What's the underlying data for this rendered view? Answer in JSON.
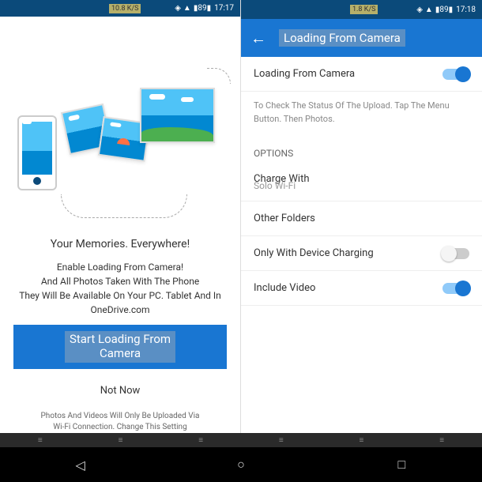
{
  "statusbar": {
    "left": {
      "speed": "10.8 K/S",
      "time": "17:17"
    },
    "right": {
      "speed": "1.8 K/S",
      "time": "17:18"
    },
    "battery": "89"
  },
  "left_screen": {
    "title": "Your Memories. Everywhere!",
    "description_line1": "Enable Loading From Camera!",
    "description_line2": "And All Photos Taken With The Phone",
    "description_line3": "They Will Be Available On Your PC. Tablet And In",
    "description_line4": "OneDrive.com",
    "start_button_line1": "Start Loading From",
    "start_button_line2": "Camera",
    "not_now": "Not Now",
    "footer_line1": "Photos And Videos Will Only Be Uploaded Via",
    "footer_line2": "Wi-Fi Connection. Change This Setting"
  },
  "right_screen": {
    "header_title": "Loading From Camera",
    "main_toggle_label": "Loading From Camera",
    "status_desc": "To Check The Status Of The Upload. Tap The Menu Button. Then Photos.",
    "options_label": "OPTIONS",
    "charge_with_label": "Charge With",
    "charge_with_value": "Solo Wi-Fi",
    "other_folders": "Other Folders",
    "only_charging": "Only With Device Charging",
    "include_video": "Include Video"
  },
  "toggles": {
    "loading_camera": true,
    "only_charging": false,
    "include_video": true
  }
}
